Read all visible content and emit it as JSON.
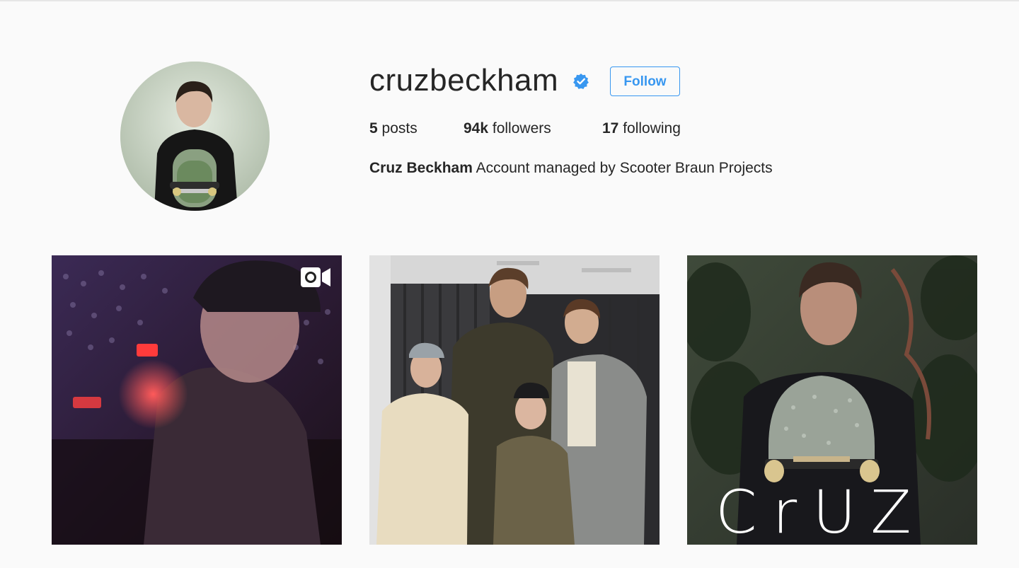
{
  "profile": {
    "username": "cruzbeckham",
    "verified": true,
    "follow_label": "Follow",
    "stats": {
      "posts_count": "5",
      "posts_label": " posts",
      "followers_count": "94k",
      "followers_label": " followers",
      "following_count": "17",
      "following_label": " following"
    },
    "full_name": "Cruz Beckham",
    "bio": " Account managed by Scooter Braun Projects"
  },
  "posts": [
    {
      "type": "video",
      "icon": "video-camera-icon"
    },
    {
      "type": "photo"
    },
    {
      "type": "photo",
      "overlay_text": "CrUZ"
    }
  ],
  "colors": {
    "accent": "#3897f0",
    "verified": "#3897f0",
    "background": "#fafafa",
    "text": "#262626"
  }
}
